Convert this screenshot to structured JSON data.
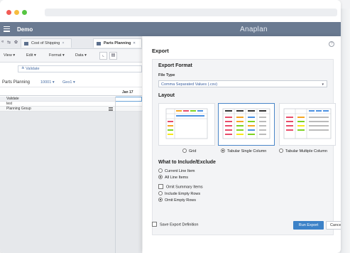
{
  "app": {
    "title": "Demo",
    "brand": "Anaplan"
  },
  "tabs": [
    {
      "label": "Cost of Shipping"
    },
    {
      "label": "Parts Planning"
    }
  ],
  "toolbar": {
    "view": "View ▾",
    "edit": "Edit ▾",
    "format": "Format ▾",
    "data": "Data ▾"
  },
  "validate": {
    "label": "Validate"
  },
  "planning": {
    "title": "Parts Planning",
    "dd1": "10001 ▾",
    "dd2": "Geo1 ▾"
  },
  "grid": {
    "column": "Jan 17",
    "rows": [
      "Validate",
      "test",
      "Planning Group"
    ]
  },
  "dialog": {
    "title": "Export",
    "export_format_heading": "Export Format",
    "file_type_label": "File Type",
    "file_type_value": "Comma Separated Values (.csv)",
    "layout_heading": "Layout",
    "layouts": [
      {
        "label": "Grid",
        "selected": false
      },
      {
        "label": "Tabular Single Column",
        "selected": true
      },
      {
        "label": "Tabular Multiple Column",
        "selected": false
      }
    ],
    "include_heading": "What to Include/Exclude",
    "line_options": [
      {
        "label": "Current Line Item",
        "selected": false
      },
      {
        "label": "All Line Items",
        "selected": true
      }
    ],
    "omit_summary": {
      "label": "Omit Summary Items",
      "checked": false
    },
    "row_options": [
      {
        "label": "Include Empty Rows",
        "selected": false
      },
      {
        "label": "Omit Empty Rows",
        "selected": true
      }
    ],
    "save_definition": "Save Export Definition",
    "run_label": "Run Export",
    "cancel_label": "Cancel"
  },
  "colors": {
    "header": "#6a7a91",
    "accent": "#3c82c8",
    "link": "#4a6fa5"
  },
  "icons": {
    "help": "?",
    "close": "×",
    "caret": "▾"
  }
}
